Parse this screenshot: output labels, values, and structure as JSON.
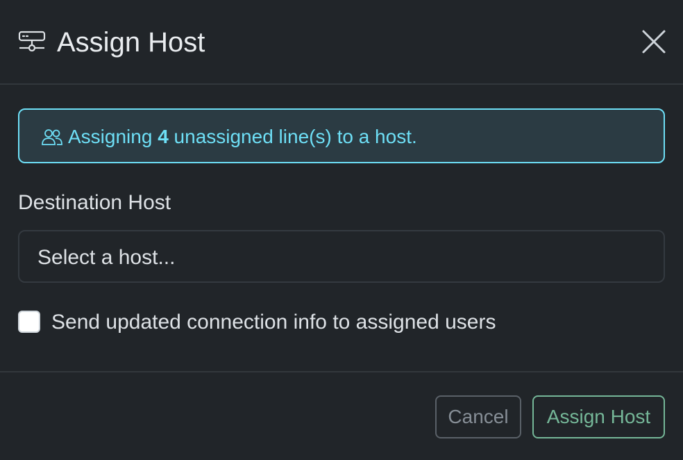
{
  "modal": {
    "title": "Assign Host",
    "header_icon": "server-icon",
    "close_icon": "close-icon"
  },
  "alert": {
    "icon": "users-icon",
    "prefix": "Assigning ",
    "count": "4",
    "suffix": " unassigned line(s) to a host.",
    "color": "#6edff6"
  },
  "form": {
    "destination_label": "Destination Host",
    "destination_placeholder": "Select a host...",
    "notify_checkbox_checked": false,
    "notify_label": "Send updated connection info to assigned users"
  },
  "footer": {
    "cancel_label": "Cancel",
    "assign_label": "Assign Host",
    "assign_color": "#75b798"
  }
}
